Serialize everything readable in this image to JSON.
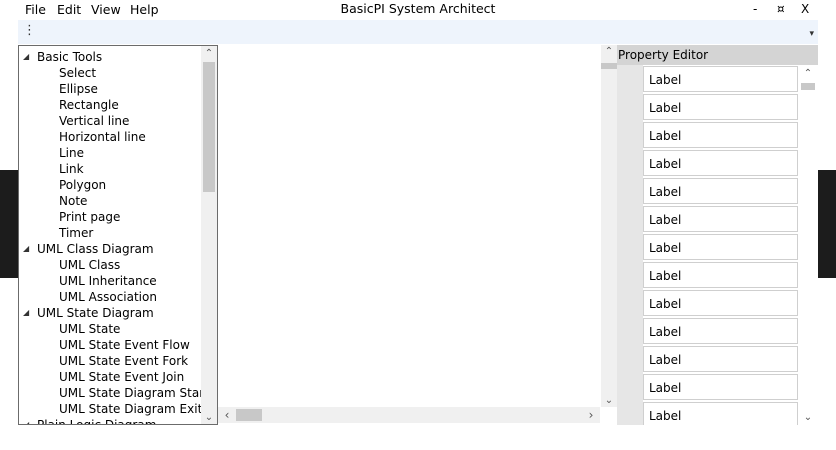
{
  "window": {
    "title": "BasicPI System Architect",
    "controls": {
      "minimize": "-",
      "restore": "¤",
      "close": "X"
    }
  },
  "menu": {
    "file": "File",
    "edit": "Edit",
    "view": "View",
    "help": "Help"
  },
  "toolbar": {
    "grip_icon": "grip-dots-icon",
    "overflow_icon": "overflow-arrow-icon"
  },
  "tree": {
    "categories": [
      {
        "label": "Basic Tools",
        "items": [
          "Select",
          "Ellipse",
          "Rectangle",
          "Vertical line",
          "Horizontal line",
          "Line",
          "Link",
          "Polygon",
          "Note",
          "Print page",
          "Timer"
        ]
      },
      {
        "label": "UML Class Diagram",
        "items": [
          "UML Class",
          "UML Inheritance",
          "UML Association"
        ]
      },
      {
        "label": "UML State Diagram",
        "items": [
          "UML State",
          "UML State Event Flow",
          "UML State Event Fork",
          "UML State Event Join",
          "UML State Diagram Start",
          "UML State Diagram Exit"
        ]
      },
      {
        "label": "Plain Logic Diagram",
        "items": []
      }
    ]
  },
  "property_editor": {
    "title": "Property Editor",
    "rows": [
      "Label",
      "Label",
      "Label",
      "Label",
      "Label",
      "Label",
      "Label",
      "Label",
      "Label",
      "Label",
      "Label",
      "Label",
      "Label"
    ]
  },
  "colors": {
    "toolbar_bg": "#eef4fc",
    "header_bg": "#d4d4d4",
    "gutter_bg": "#e6e6e6",
    "dark_band": "#1c1c1c"
  }
}
